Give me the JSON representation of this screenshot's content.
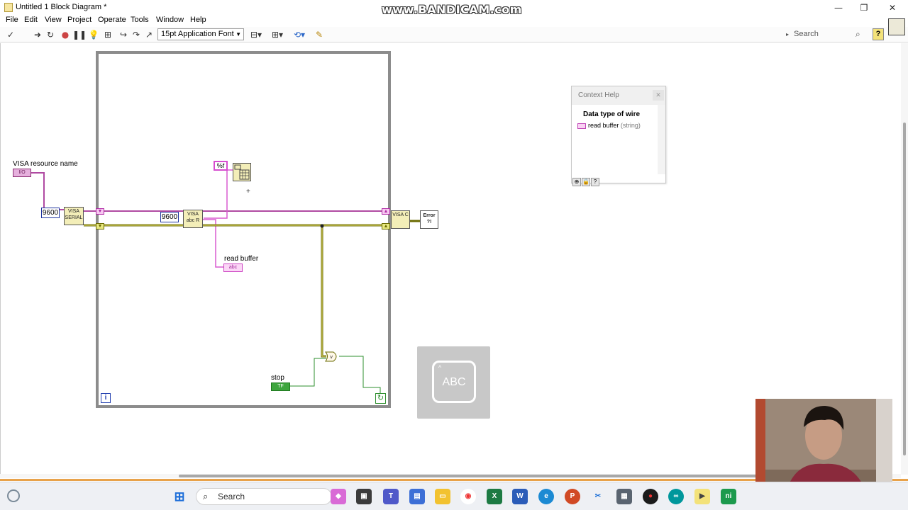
{
  "window": {
    "title": "Untitled 1 Block Diagram *",
    "watermark": "www.BANDICAM.com",
    "minimize": "—",
    "maximize": "❐",
    "close": "✕"
  },
  "menu": [
    "File",
    "Edit",
    "View",
    "Project",
    "Operate",
    "Tools",
    "Window",
    "Help"
  ],
  "toolbar": {
    "font_select": "15pt Application Font",
    "search_placeholder": "Search",
    "help_label": "?"
  },
  "diagram": {
    "visa_resource_label": "VISA resource name",
    "visa_terminal": "I/O",
    "baud_const": "9600",
    "bytes_const": "9600",
    "format_const": "%f",
    "read_buffer_label": "read buffer",
    "read_buffer_terminal": "abc",
    "stop_label": "stop",
    "stop_terminal": "TF",
    "iteration_symbol": "i",
    "configure_vi_text": "VISA SERIAL",
    "read_vi_text": "VISA abc R",
    "close_vi_text": "VISA C",
    "error_vi_text": "Error ?!"
  },
  "context_help": {
    "title": "Context Help",
    "close": "✕",
    "heading": "Data type of wire",
    "wire_name": "read buffer",
    "wire_type": "(string)"
  },
  "overlay": {
    "abc_text": "ABC"
  },
  "taskbar": {
    "search_label": "Search"
  }
}
